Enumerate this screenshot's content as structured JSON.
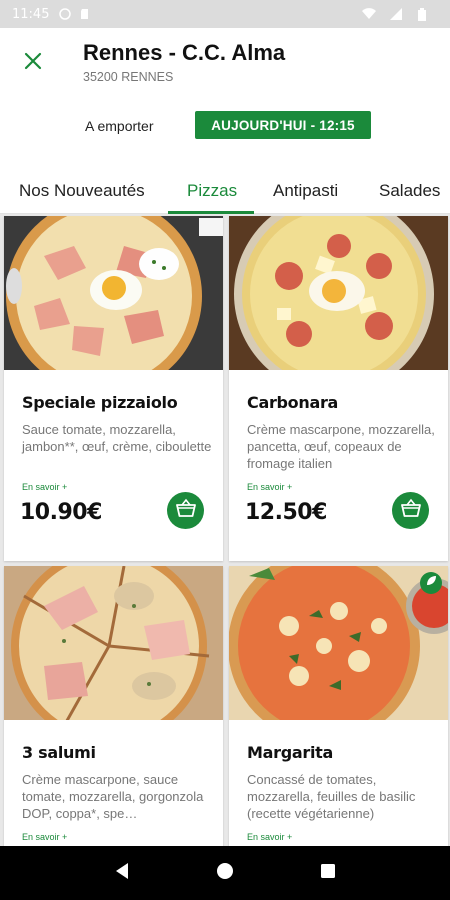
{
  "status_bar": {
    "time": "11:45"
  },
  "store": {
    "name": "Rennes - C.C. Alma",
    "city": "35200 RENNES"
  },
  "order": {
    "mode_label": "A emporter",
    "time_badge": "AUJOURD'HUI - 12:15"
  },
  "tabs": [
    {
      "label": "Nos Nouveautés",
      "active": false
    },
    {
      "label": "Pizzas",
      "active": true
    },
    {
      "label": "Antipasti",
      "active": false
    },
    {
      "label": "Salades",
      "active": false
    }
  ],
  "products": [
    {
      "name": "Speciale pizzaiolo",
      "description": "Sauce tomate, mozzarella, jambon**, œuf, crème, ciboulette",
      "more_label": "En savoir +",
      "price": "10.90€"
    },
    {
      "name": "Carbonara",
      "description": "Crème mascarpone, mozzarella, pancetta, œuf, copeaux de fromage italien",
      "more_label": "En savoir +",
      "price": "12.50€"
    },
    {
      "name": "3 salumi",
      "description": "Crème mascarpone, sauce tomate, mozzarella, gorgonzola DOP, coppa*, spe…",
      "more_label": "En savoir +",
      "price": ""
    },
    {
      "name": "Margarita",
      "description": "Concassé de tomates, mozzarella, feuilles de basilic (recette végétarienne)",
      "more_label": "En savoir +",
      "price": ""
    }
  ],
  "colors": {
    "accent": "#1b8a3b",
    "background": "#e8e8e8"
  }
}
